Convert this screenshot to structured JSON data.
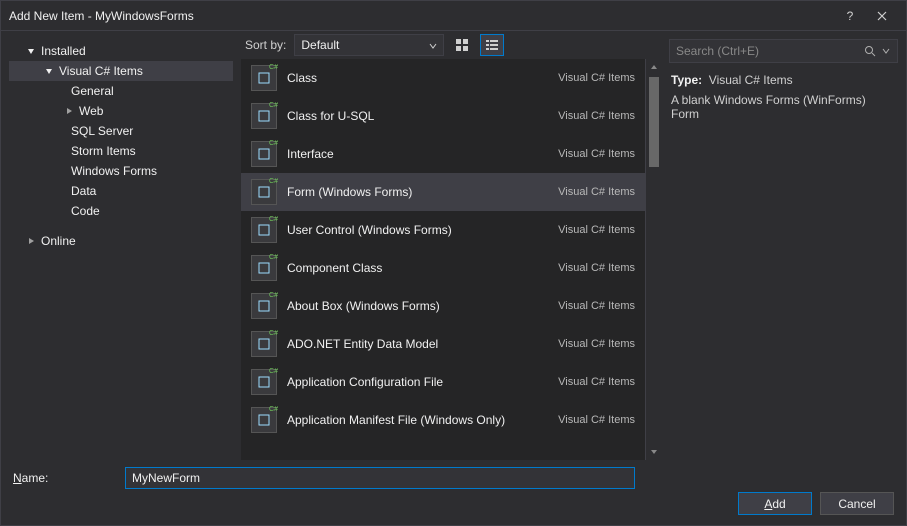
{
  "window": {
    "title": "Add New Item - MyWindowsForms"
  },
  "tree": {
    "installed": "Installed",
    "csharp_items": "Visual C# Items",
    "general": "General",
    "web": "Web",
    "sql_server": "SQL Server",
    "storm_items": "Storm Items",
    "windows_forms": "Windows Forms",
    "data": "Data",
    "code": "Code",
    "online": "Online"
  },
  "sort": {
    "label": "Sort by:",
    "value": "Default"
  },
  "search": {
    "placeholder": "Search (Ctrl+E)"
  },
  "info": {
    "type_label": "Type:",
    "type_value": "Visual C# Items",
    "description": "A blank Windows Forms (WinForms) Form"
  },
  "items": {
    "lang": "Visual C# Items",
    "list": [
      {
        "name": "Class"
      },
      {
        "name": "Class for U-SQL"
      },
      {
        "name": "Interface"
      },
      {
        "name": "Form (Windows Forms)"
      },
      {
        "name": "User Control (Windows Forms)"
      },
      {
        "name": "Component Class"
      },
      {
        "name": "About Box (Windows Forms)"
      },
      {
        "name": "ADO.NET Entity Data Model"
      },
      {
        "name": "Application Configuration File"
      },
      {
        "name": "Application Manifest File (Windows Only)"
      }
    ],
    "selected_index": 3
  },
  "nameField": {
    "label_pre": "N",
    "label_post": "ame:",
    "value": "MyNewForm"
  },
  "buttons": {
    "add_pre": "A",
    "add_post": "dd",
    "cancel": "Cancel"
  }
}
